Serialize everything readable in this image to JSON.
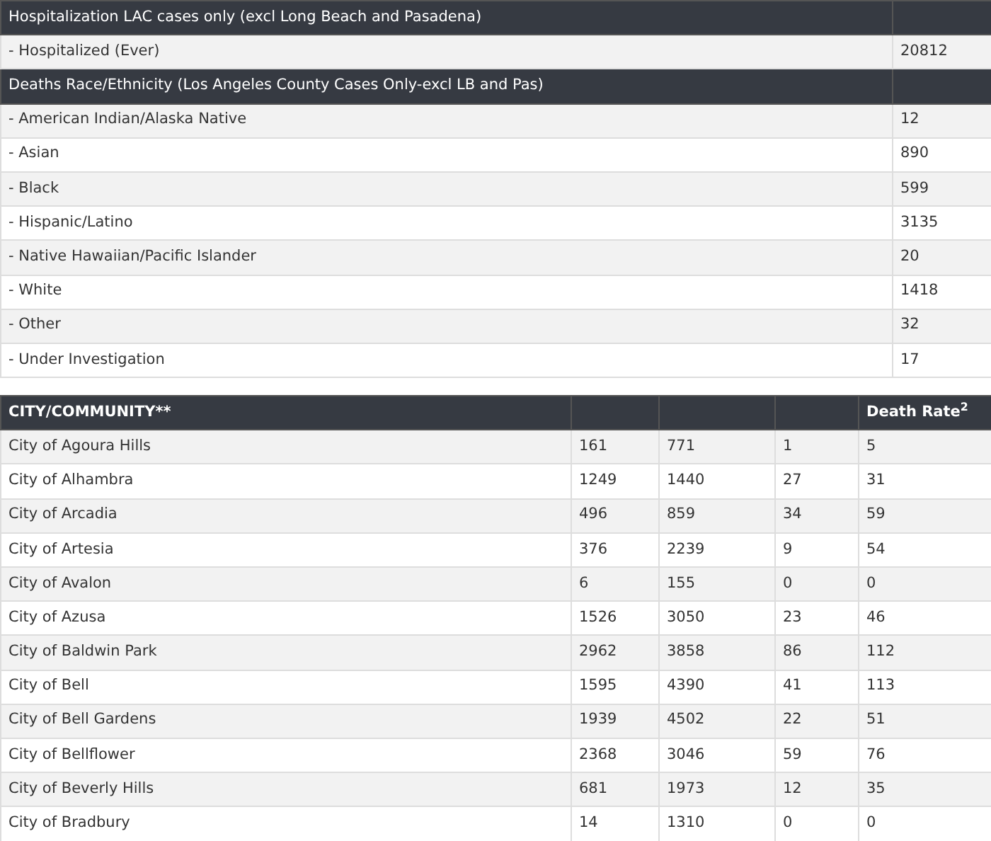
{
  "summary_table": {
    "sections": [
      {
        "heading": "Hospitalization LAC cases only (excl Long Beach and Pasadena)",
        "rows": [
          {
            "label": "- Hospitalized (Ever)",
            "value": "20812"
          }
        ]
      },
      {
        "heading": "Deaths Race/Ethnicity (Los Angeles County Cases Only-excl LB and Pas)",
        "rows": [
          {
            "label": "- American Indian/Alaska Native",
            "value": "12"
          },
          {
            "label": "- Asian",
            "value": "890"
          },
          {
            "label": "- Black",
            "value": "599"
          },
          {
            "label": "- Hispanic/Latino",
            "value": "3135"
          },
          {
            "label": "- Native Hawaiian/Pacific Islander",
            "value": "20"
          },
          {
            "label": "- White",
            "value": "1418"
          },
          {
            "label": "- Other",
            "value": "32"
          },
          {
            "label": "- Under Investigation",
            "value": "17"
          }
        ]
      }
    ]
  },
  "city_table": {
    "columns": [
      "CITY/COMMUNITY**",
      "",
      "",
      "",
      "Death Rate$^{2}$"
    ],
    "rows": [
      [
        "City of Agoura Hills",
        "161",
        "771",
        "1",
        "5"
      ],
      [
        "City of Alhambra",
        "1249",
        "1440",
        "27",
        "31"
      ],
      [
        "City of Arcadia",
        "496",
        "859",
        "34",
        "59"
      ],
      [
        "City of Artesia",
        "376",
        "2239",
        "9",
        "54"
      ],
      [
        "City of Avalon",
        "6",
        "155",
        "0",
        "0"
      ],
      [
        "City of Azusa",
        "1526",
        "3050",
        "23",
        "46"
      ],
      [
        "City of Baldwin Park",
        "2962",
        "3858",
        "86",
        "112"
      ],
      [
        "City of Bell",
        "1595",
        "4390",
        "41",
        "113"
      ],
      [
        "City of Bell Gardens",
        "1939",
        "4502",
        "22",
        "51"
      ],
      [
        "City of Bellflower",
        "2368",
        "3046",
        "59",
        "76"
      ],
      [
        "City of Beverly Hills",
        "681",
        "1973",
        "12",
        "35"
      ],
      [
        "City of Bradbury",
        "14",
        "1310",
        "0",
        "0"
      ]
    ]
  }
}
